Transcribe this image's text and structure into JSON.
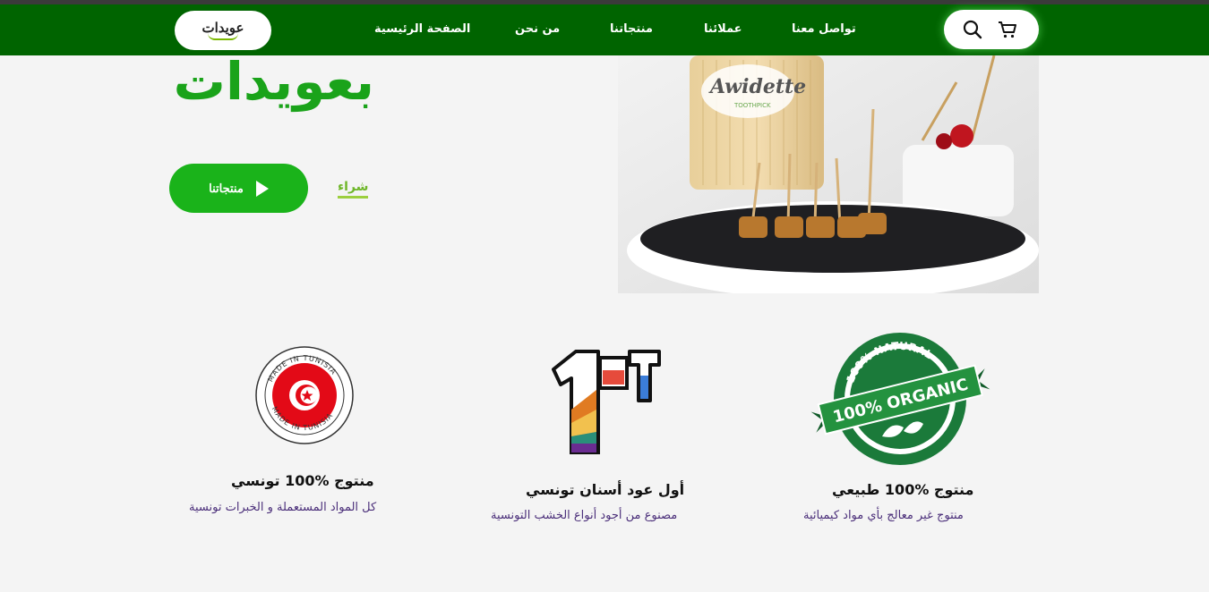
{
  "nav": {
    "logo_text": "عويدات",
    "links": [
      "الصفحة الرئيسية",
      "من نحن",
      "منتجاتنا",
      "عملائنا",
      "تواصل معنا"
    ],
    "search_icon": "search-icon",
    "cart_icon": "cart-icon"
  },
  "hero": {
    "title": "بعويدات",
    "cta_label": "منتجاتنا",
    "buy_label": "شراء",
    "image_brand_text": "Awidette",
    "image_brand_sub": "TOOTHPICK"
  },
  "features": [
    {
      "badge_line1": "MADE IN TUNISIA",
      "badge_line2": "MADE IN TUNISIA",
      "title": "منتوج %100 تونسي",
      "desc": "كل المواد المستعملة و الخبرات تونسية"
    },
    {
      "badge_text": "1st",
      "title": "أول عود أسنان تونسي",
      "desc": "مصنوع من أجود أنواع الخشب التونسية"
    },
    {
      "badge_line1": "100% NATURAL",
      "badge_line2": "100% ORGANIC",
      "title": "منتوج %100 طبيعي",
      "desc": "منتوج غير معالج بأي مواد كيميائية"
    }
  ],
  "colors": {
    "nav_bg": "#006400",
    "accent_green": "#1ab31a",
    "desc_purple": "#4b2f7a"
  }
}
